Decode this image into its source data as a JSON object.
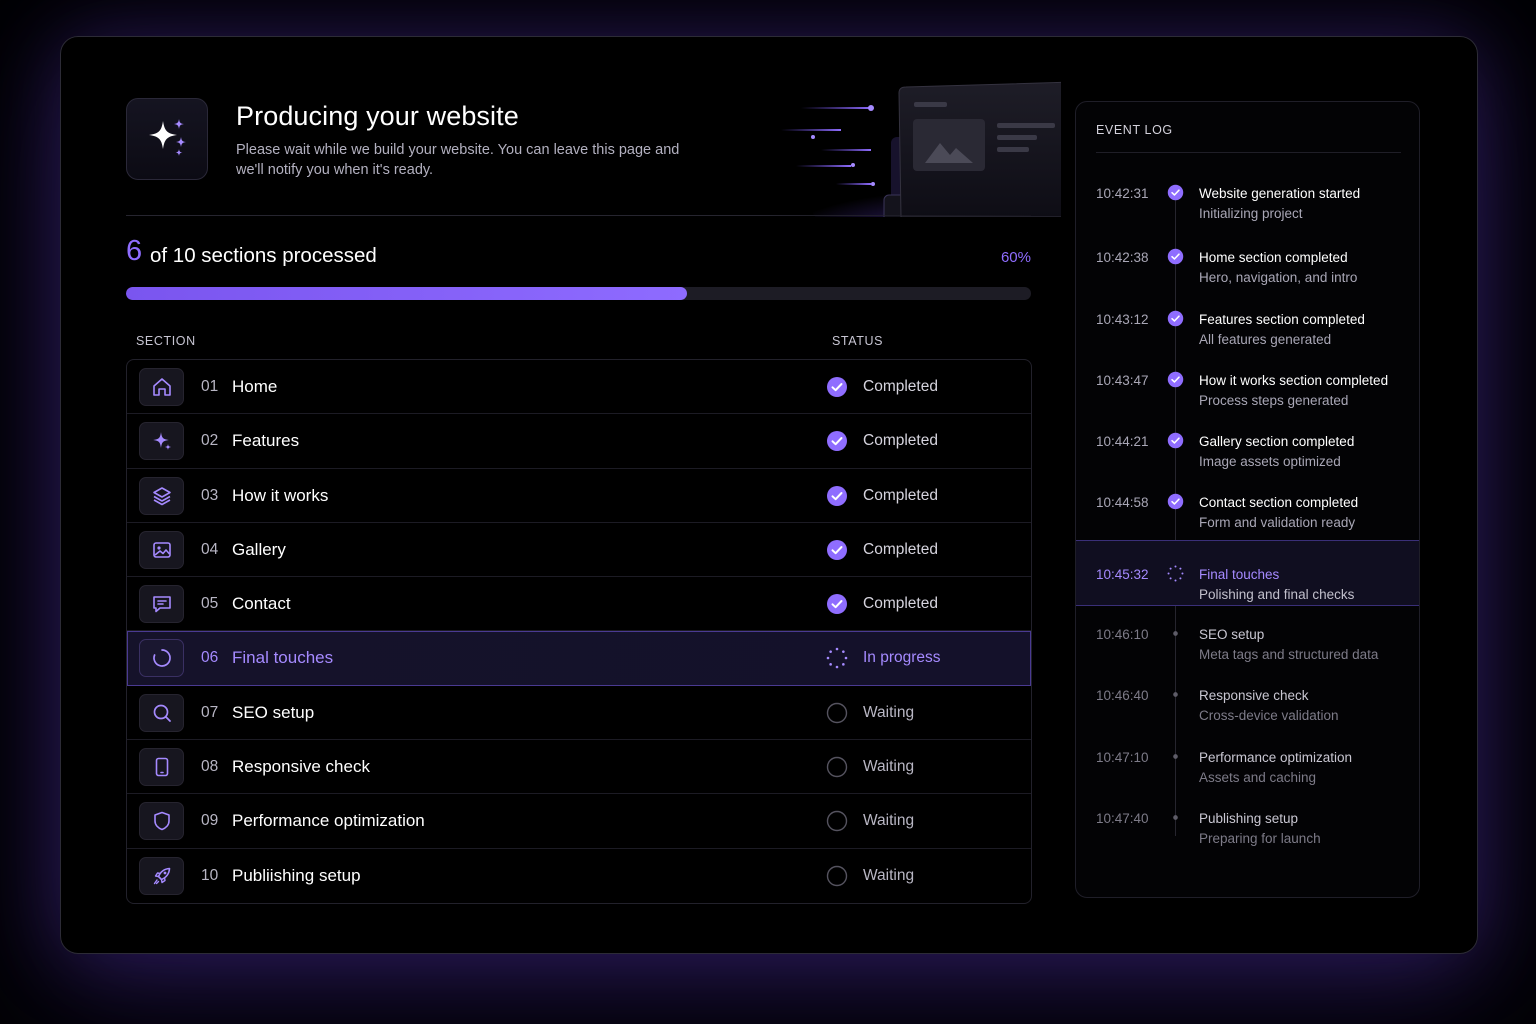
{
  "header": {
    "title": "Producing your website",
    "subtitle": "Please wait while we build your website. You can leave this page and we'll notify you when it's ready.",
    "logo_icon": "sparkles-icon"
  },
  "progress": {
    "count": "6",
    "label": "of 10 sections processed",
    "percent_label": "60%",
    "fraction": 0.62
  },
  "table": {
    "col_section": "SECTION",
    "col_status": "STATUS",
    "rows": [
      {
        "num": "01",
        "name": "Home",
        "status": "Completed",
        "icon": "home-icon",
        "state": "done"
      },
      {
        "num": "02",
        "name": "Features",
        "status": "Completed",
        "icon": "sparkle-icon",
        "state": "done"
      },
      {
        "num": "03",
        "name": "How it works",
        "status": "Completed",
        "icon": "layers-icon",
        "state": "done"
      },
      {
        "num": "04",
        "name": "Gallery",
        "status": "Completed",
        "icon": "image-icon",
        "state": "done"
      },
      {
        "num": "05",
        "name": "Contact",
        "status": "Completed",
        "icon": "message-icon",
        "state": "done"
      },
      {
        "num": "06",
        "name": "Final touches",
        "status": "In progress",
        "icon": "loader-icon",
        "state": "active"
      },
      {
        "num": "07",
        "name": "SEO setup",
        "status": "Waiting",
        "icon": "search-icon",
        "state": "waiting"
      },
      {
        "num": "08",
        "name": "Responsive check",
        "status": "Waiting",
        "icon": "tablet-icon",
        "state": "waiting"
      },
      {
        "num": "09",
        "name": "Performance optimization",
        "status": "Waiting",
        "icon": "shield-icon",
        "state": "waiting"
      },
      {
        "num": "10",
        "name": "Publiishing setup",
        "status": "Waiting",
        "icon": "rocket-icon",
        "state": "waiting"
      }
    ]
  },
  "event_log": {
    "title": "EVENT LOG",
    "events": [
      {
        "time": "10:42:31",
        "title": "Website generation started",
        "sub": "Initializing project",
        "state": "done"
      },
      {
        "time": "10:42:38",
        "title": "Home section completed",
        "sub": "Hero, navigation, and intro",
        "state": "done"
      },
      {
        "time": "10:43:12",
        "title": "Features section completed",
        "sub": "All features generated",
        "state": "done"
      },
      {
        "time": "10:43:47",
        "title": "How it works section completed",
        "sub": "Process steps generated",
        "state": "done"
      },
      {
        "time": "10:44:21",
        "title": "Gallery section completed",
        "sub": "Image assets optimized",
        "state": "done"
      },
      {
        "time": "10:44:58",
        "title": "Contact section completed",
        "sub": "Form and validation ready",
        "state": "done"
      },
      {
        "time": "10:45:32",
        "title": "Final touches",
        "sub": "Polishing and final checks",
        "state": "active"
      },
      {
        "time": "10:46:10",
        "title": "SEO setup",
        "sub": "Meta tags and structured data",
        "state": "pending"
      },
      {
        "time": "10:46:40",
        "title": "Responsive check",
        "sub": "Cross-device validation",
        "state": "pending"
      },
      {
        "time": "10:47:10",
        "title": "Performance optimization",
        "sub": "Assets and caching",
        "state": "pending"
      },
      {
        "time": "10:47:40",
        "title": "Publishing setup",
        "sub": "Preparing for launch",
        "state": "pending"
      }
    ]
  },
  "colors": {
    "accent": "#8f6dff",
    "background": "#000000",
    "panel_border": "#2c2b36"
  }
}
